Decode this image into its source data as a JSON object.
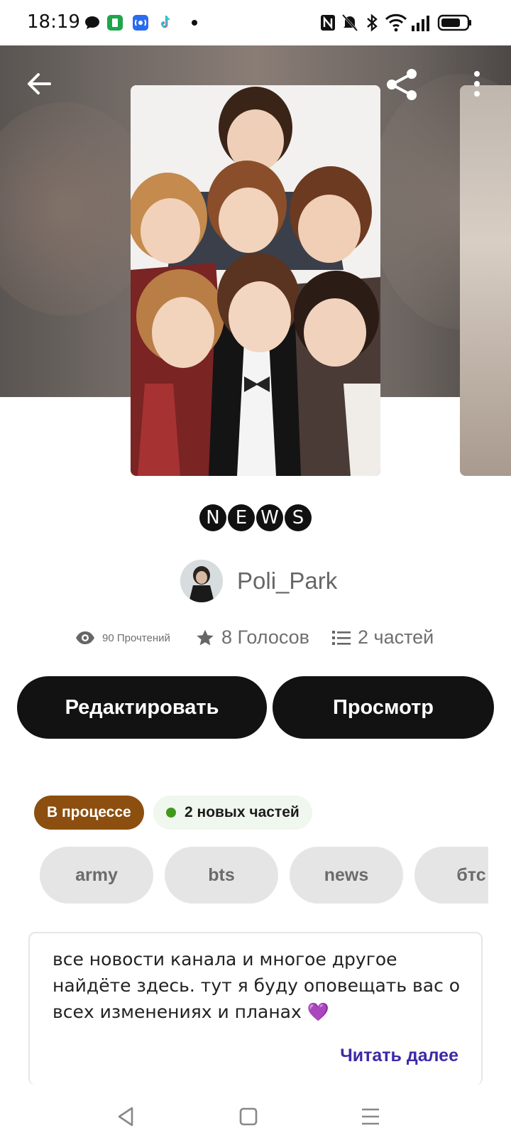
{
  "status_bar": {
    "time": "18:19",
    "icons_left": [
      "chat-bubble-icon",
      "green-app-icon",
      "blue-app-icon",
      "tiktok-icon",
      "dot-icon"
    ],
    "icons_right": [
      "nfc-icon",
      "muted-bell-icon",
      "bluetooth-icon",
      "wifi-icon",
      "signal-icon",
      "battery-icon"
    ]
  },
  "header": {
    "back_icon": "arrow-left-icon",
    "share_icon": "share-icon",
    "more_icon": "more-vertical-icon"
  },
  "story": {
    "title_letters": [
      "N",
      "E",
      "W",
      "S"
    ],
    "author": "Poli_Park",
    "reads": "90 Прочтений",
    "votes": "8 Голосов",
    "parts": "2 частей"
  },
  "actions": {
    "edit_label": "Редактировать",
    "view_label": "Просмотр"
  },
  "badges": {
    "status": "В процессе",
    "new_parts": "2 новых частей"
  },
  "tags": [
    "army",
    "bts",
    "news",
    "бтс"
  ],
  "description": {
    "text": "все новости канала и многое другое найдёте здесь. тут я буду оповещать вас о всех изменениях и планах 💜",
    "read_more": "Читать далее"
  },
  "colors": {
    "button_bg": "#121212",
    "status_chip": "#8c4f0f",
    "new_chip_bg": "#f0f7ee",
    "green_dot": "#3f9a1a",
    "tag_bg": "#e6e5e6",
    "read_more": "#3b2aa6"
  },
  "nav": [
    "back-nav-icon",
    "home-nav-icon",
    "menu-nav-icon"
  ]
}
